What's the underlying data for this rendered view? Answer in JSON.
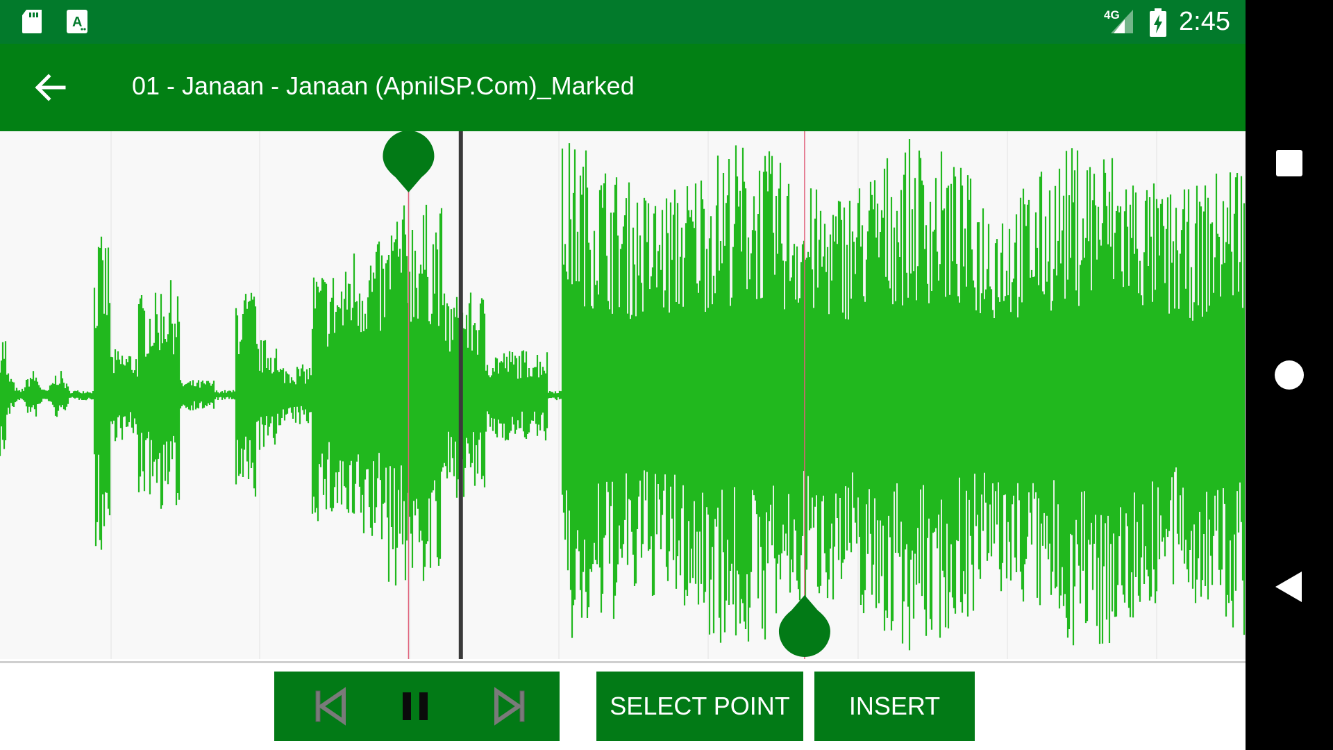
{
  "status_bar": {
    "time": "2:45",
    "network_label": "4G",
    "icons": [
      "sd-card-icon",
      "text-notification-icon",
      "signal-icon",
      "battery-charging-icon"
    ]
  },
  "app_bar": {
    "title": "01 - Janaan - Janaan (ApnilSP.Com)_Marked",
    "back_icon": "arrow-left-icon"
  },
  "waveform": {
    "wave_color": "#21b81e",
    "marker_color": "#027a16",
    "start_marker_position": 0.328,
    "end_marker_position": 0.646,
    "playhead_position": 0.37
  },
  "controls": {
    "previous_icon": "skip-previous-icon",
    "pause_icon": "pause-icon",
    "next_icon": "skip-next-icon",
    "select_point_label": "SELECT POINT",
    "insert_label": "INSERT"
  },
  "nav_bar": {
    "icons": [
      "recents-square-icon",
      "home-circle-icon",
      "back-triangle-icon"
    ]
  },
  "colors": {
    "status_bar": "#027a2b",
    "app_bar": "#028014",
    "button": "#027a16",
    "waveform_bg": "#f8f8f8"
  }
}
